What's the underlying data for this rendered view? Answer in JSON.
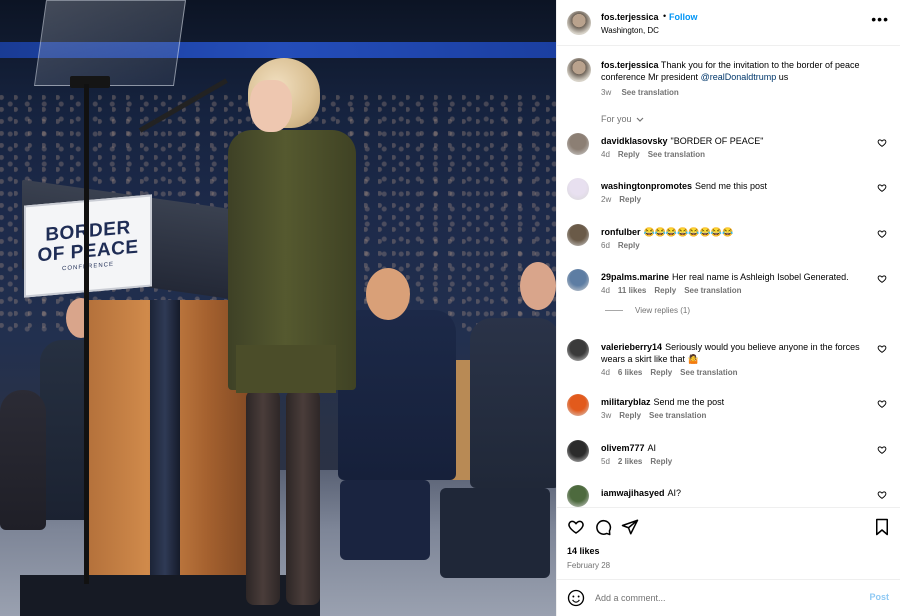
{
  "post": {
    "username": "fos.terjessica",
    "follow_label": "Follow",
    "separator": "•",
    "location": "Washington, DC",
    "more_label": "•••"
  },
  "photo": {
    "sign_line1": "BORDER",
    "sign_line2": "OF PEACE",
    "sign_line3": "CONFERENCE"
  },
  "caption": {
    "username": "fos.terjessica",
    "text": "Thank you for the invitation to the border of peace conference Mr president",
    "mention": "@realDonaldtrump",
    "tail": "us",
    "time": "3w",
    "see_translation": "See translation"
  },
  "for_you_label": "For you",
  "comments": [
    {
      "user": "davidklasovsky",
      "text": "\"BORDER OF PEACE\"",
      "time": "4d",
      "likes": "",
      "reply": "Reply",
      "translate": "See translation",
      "avatar_color": "#8c7f74"
    },
    {
      "user": "washingtonpromotes",
      "text": "Send me this post",
      "time": "2w",
      "likes": "",
      "reply": "Reply",
      "translate": "",
      "avatar_color": "#e8e0f0"
    },
    {
      "user": "ronfulber",
      "text": "😂😂😂😂😂😂😂😂",
      "time": "6d",
      "likes": "",
      "reply": "Reply",
      "translate": "",
      "avatar_color": "#6a5a48"
    },
    {
      "user": "29palms.marine",
      "text": "Her real name is Ashleigh Isobel Generated.",
      "time": "4d",
      "likes": "11 likes",
      "reply": "Reply",
      "translate": "See translation",
      "avatar_color": "#5d7da3",
      "view_replies": "View replies (1)"
    },
    {
      "user": "valerieberry14",
      "text": "Seriously would you believe anyone in the forces wears a skirt like that 🤷",
      "time": "4d",
      "likes": "6 likes",
      "reply": "Reply",
      "translate": "See translation",
      "avatar_color": "#3a3a3a"
    },
    {
      "user": "militaryblaz",
      "text": "Send me the post",
      "time": "3w",
      "likes": "",
      "reply": "Reply",
      "translate": "See translation",
      "avatar_color": "#e25a1c"
    },
    {
      "user": "olivem777",
      "text": "AI",
      "time": "5d",
      "likes": "2 likes",
      "reply": "Reply",
      "translate": "",
      "avatar_color": "#2b2b2b"
    },
    {
      "user": "iamwajihasyed",
      "text": "AI?",
      "time": "",
      "likes": "",
      "reply": "",
      "translate": "",
      "avatar_color": "#4d6a3e"
    }
  ],
  "footer": {
    "likes": "14 likes",
    "date": "February 28"
  },
  "composer": {
    "placeholder": "Add a comment...",
    "post_label": "Post"
  },
  "colors": {
    "link_blue": "#0095f6",
    "mention_blue": "#00376b",
    "muted": "#737373",
    "post_disabled": "#8fc9f4"
  },
  "icons": {
    "heart": "heart-icon",
    "comment": "comment-icon",
    "share": "share-icon",
    "save": "bookmark-icon",
    "emoji": "emoji-icon",
    "more": "more-options-icon"
  }
}
